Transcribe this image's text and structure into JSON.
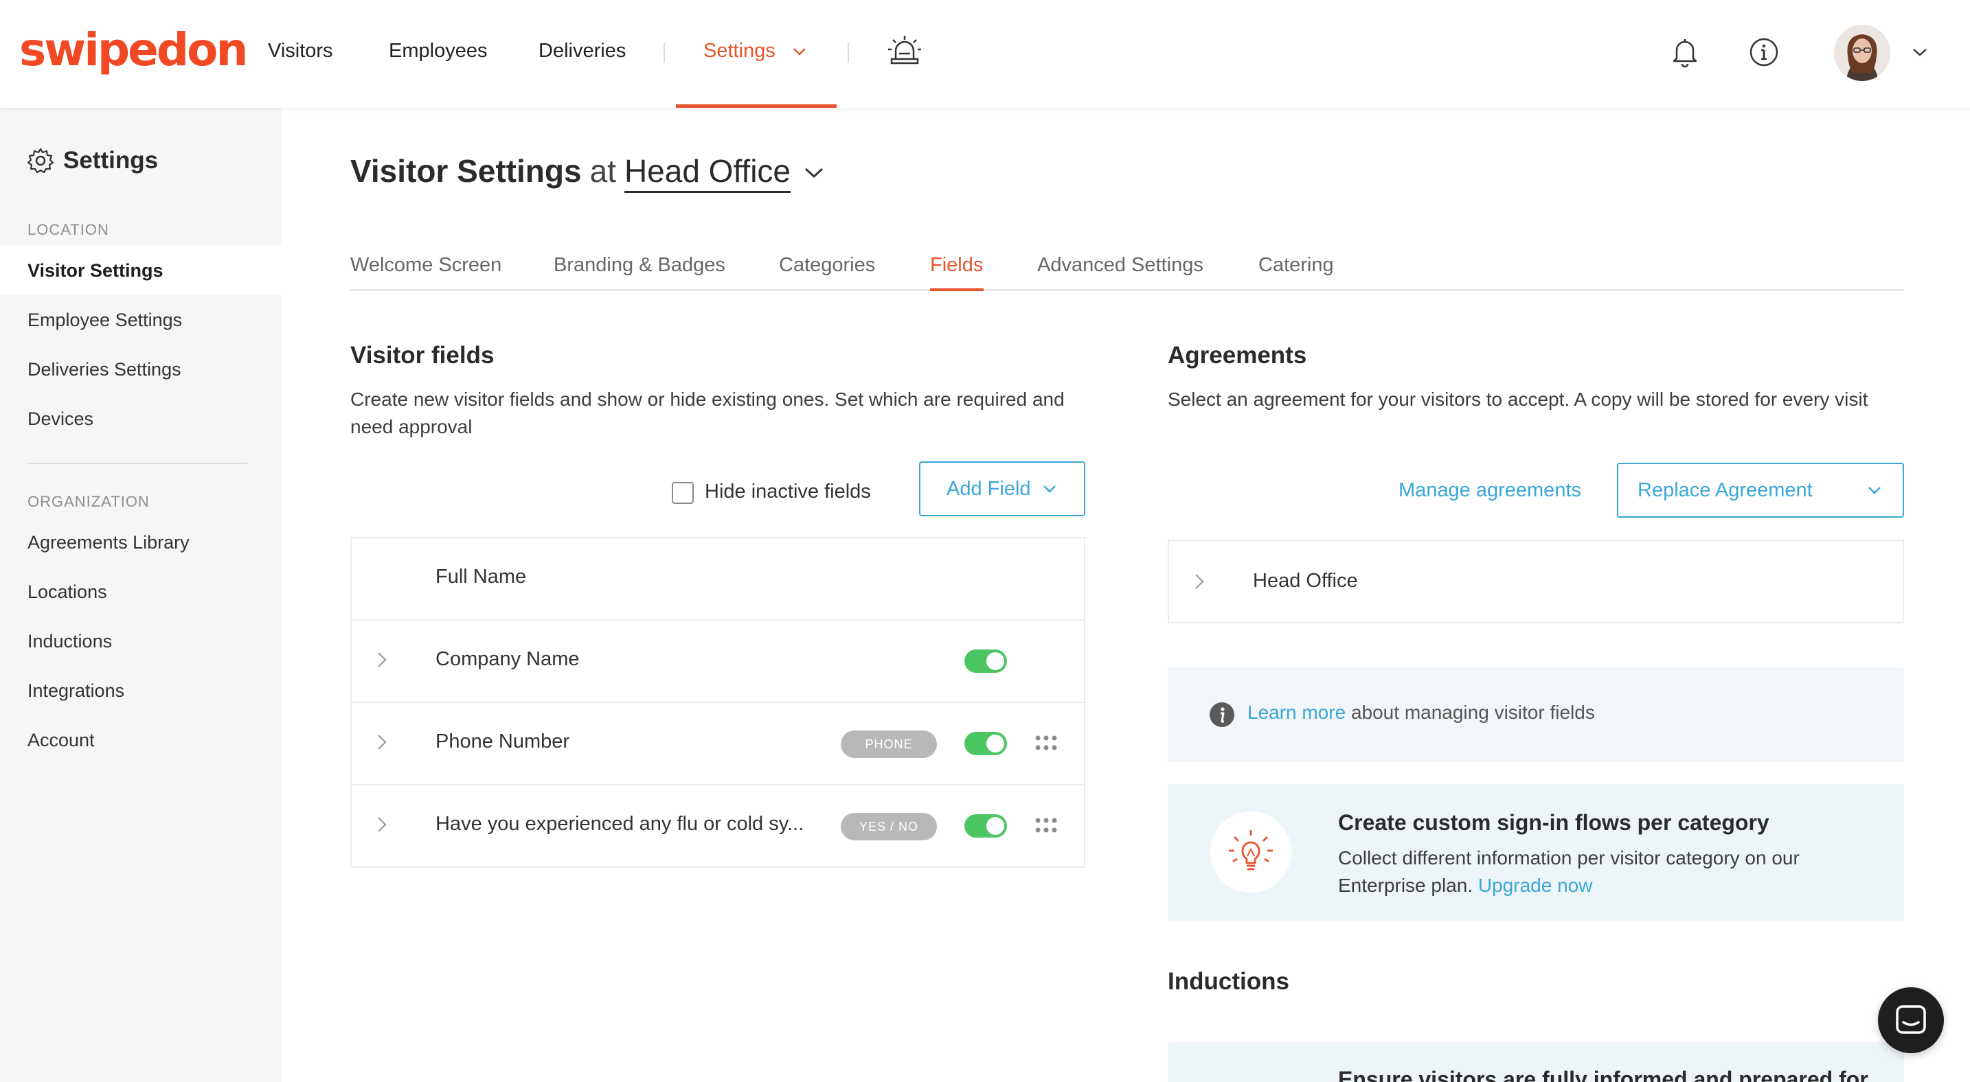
{
  "brand": {
    "logo_text": "swipedon",
    "accent": "#e8532b",
    "link": "#3aa7d6",
    "toggle_on": "#4cc563"
  },
  "nav": {
    "items": [
      "Visitors",
      "Employees",
      "Deliveries"
    ],
    "settings_label": "Settings",
    "alert_icon": "siren-icon",
    "bell_icon": "bell-icon",
    "info_icon": "info-icon",
    "avatar_icon": "user-avatar"
  },
  "sidebar": {
    "title": "Settings",
    "location_heading": "LOCATION",
    "location_items": [
      "Visitor Settings",
      "Employee Settings",
      "Deliveries Settings",
      "Devices"
    ],
    "active_item": "Visitor Settings",
    "organization_heading": "ORGANIZATION",
    "organization_items": [
      "Agreements Library",
      "Locations",
      "Inductions",
      "Integrations",
      "Account"
    ]
  },
  "header": {
    "title": "Visitor Settings",
    "at": "at",
    "location": "Head Office"
  },
  "tabs": [
    "Welcome Screen",
    "Branding & Badges",
    "Categories",
    "Fields",
    "Advanced Settings",
    "Catering"
  ],
  "active_tab": "Fields",
  "visitor_fields": {
    "title": "Visitor fields",
    "description": "Create new visitor fields and show or hide existing ones. Set which are required and need approval",
    "hide_inactive_label": "Hide inactive fields",
    "hide_inactive_checked": false,
    "add_field_label": "Add Field",
    "rows": [
      {
        "label": "Full Name",
        "badge": "",
        "enabled": null,
        "expandable": false,
        "draggable": false
      },
      {
        "label": "Company Name",
        "badge": "",
        "enabled": true,
        "expandable": true,
        "draggable": false
      },
      {
        "label": "Phone Number",
        "badge": "PHONE",
        "enabled": true,
        "expandable": true,
        "draggable": true
      },
      {
        "label": "Have you experienced any flu or cold sy...",
        "badge": "YES / NO",
        "enabled": true,
        "expandable": true,
        "draggable": true
      }
    ]
  },
  "agreements": {
    "title": "Agreements",
    "description": "Select an agreement for your visitors to accept. A copy will be stored for every visit",
    "manage_label": "Manage agreements",
    "replace_label": "Replace Agreement",
    "row_label": "Head Office"
  },
  "info_note": {
    "link_text": "Learn more",
    "text": "about managing visitor fields"
  },
  "promo": {
    "title": "Create custom sign-in flows per category",
    "text": "Collect different information per visitor category on our Enterprise plan.",
    "link_text": "Upgrade now",
    "icon": "lightbulb-icon"
  },
  "inductions": {
    "title": "Inductions",
    "partial_text": "Ensure visitors are fully informed and prepared for"
  },
  "chat": {
    "icon": "chat-icon"
  }
}
